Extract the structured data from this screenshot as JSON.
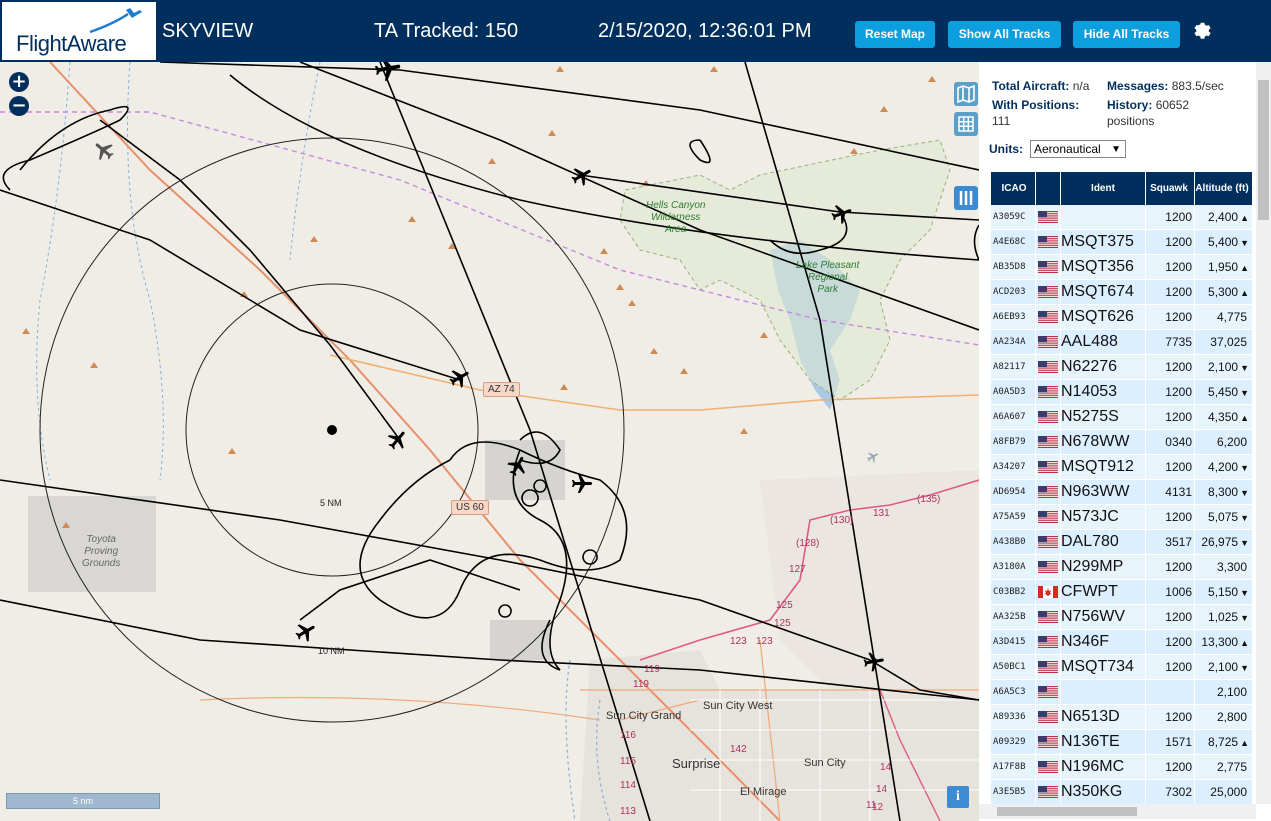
{
  "header": {
    "logo_text": "FlightAware",
    "title": "SKYVIEW",
    "tracked": "TA Tracked: 150",
    "datetime": "2/15/2020, 12:36:01 PM",
    "buttons": {
      "reset_map": "Reset Map",
      "show_all_tracks": "Show All Tracks",
      "hide_all_tracks": "Hide All Tracks"
    }
  },
  "map": {
    "zoom_in": "+",
    "zoom_out": "−",
    "shields": {
      "az74": "AZ 74",
      "us60": "US 60"
    },
    "road_numbers": [
      "(135)",
      "(130)",
      "131",
      "(128)",
      "127",
      "125",
      "125",
      "123",
      "123",
      "119",
      "119",
      "116",
      "115",
      "114",
      "113",
      "142",
      "14",
      "14",
      "12",
      "11"
    ],
    "parks": {
      "hells_canyon": "Hells Canyon\nWilderness\nArea",
      "lake_pleasant": "Lake Pleasant\nRegional\nPark"
    },
    "areas": {
      "toyota": "Toyota\nProving\nGrounds"
    },
    "cities": {
      "sun_city_grand": "Sun City Grand",
      "sun_city_west": "Sun City West",
      "surprise": "Surprise",
      "sun_city": "Sun City",
      "el_mirage": "El Mirage"
    },
    "rings": {
      "five": "5 NM",
      "ten": "10 NM"
    },
    "scale": "5 nm",
    "info": "i"
  },
  "sidebar": {
    "total_aircraft_label": "Total Aircraft:",
    "total_aircraft_value": "n/a",
    "messages_label": "Messages:",
    "messages_value": "883.5/sec",
    "with_positions_label": "With Positions:",
    "with_positions_value": "111",
    "history_label": "History:",
    "history_value": "60652",
    "history_unit": "positions",
    "units_label": "Units:",
    "units_value": "Aeronautical",
    "columns": {
      "icao": "ICAO",
      "ident": "Ident",
      "squawk": "Squawk",
      "altitude": "Altitude (ft)"
    },
    "rows": [
      {
        "icao": "A3059C",
        "flag": "US",
        "ident": "",
        "squawk": "1200",
        "alt": "2,400",
        "trend": "▲"
      },
      {
        "icao": "A4E68C",
        "flag": "US",
        "ident": "MSQT375",
        "squawk": "1200",
        "alt": "5,400",
        "trend": "▼"
      },
      {
        "icao": "AB35D8",
        "flag": "US",
        "ident": "MSQT356",
        "squawk": "1200",
        "alt": "1,950",
        "trend": "▲"
      },
      {
        "icao": "ACD203",
        "flag": "US",
        "ident": "MSQT674",
        "squawk": "1200",
        "alt": "5,300",
        "trend": "▲"
      },
      {
        "icao": "A6EB93",
        "flag": "US",
        "ident": "MSQT626",
        "squawk": "1200",
        "alt": "4,775",
        "trend": ""
      },
      {
        "icao": "AA234A",
        "flag": "US",
        "ident": "AAL488",
        "squawk": "7735",
        "alt": "37,025",
        "trend": ""
      },
      {
        "icao": "A82117",
        "flag": "US",
        "ident": "N62276",
        "squawk": "1200",
        "alt": "2,100",
        "trend": "▼"
      },
      {
        "icao": "A0A5D3",
        "flag": "US",
        "ident": "N14053",
        "squawk": "1200",
        "alt": "5,450",
        "trend": "▼"
      },
      {
        "icao": "A6A607",
        "flag": "US",
        "ident": "N5275S",
        "squawk": "1200",
        "alt": "4,350",
        "trend": "▲"
      },
      {
        "icao": "A8FB79",
        "flag": "US",
        "ident": "N678WW",
        "squawk": "0340",
        "alt": "6,200",
        "trend": ""
      },
      {
        "icao": "A34207",
        "flag": "US",
        "ident": "MSQT912",
        "squawk": "1200",
        "alt": "4,200",
        "trend": "▼"
      },
      {
        "icao": "AD6954",
        "flag": "US",
        "ident": "N963WW",
        "squawk": "4131",
        "alt": "8,300",
        "trend": "▼"
      },
      {
        "icao": "A75A59",
        "flag": "US",
        "ident": "N573JC",
        "squawk": "1200",
        "alt": "5,075",
        "trend": "▼"
      },
      {
        "icao": "A438B0",
        "flag": "US",
        "ident": "DAL780",
        "squawk": "3517",
        "alt": "26,975",
        "trend": "▼"
      },
      {
        "icao": "A3180A",
        "flag": "US",
        "ident": "N299MP",
        "squawk": "1200",
        "alt": "3,300",
        "trend": ""
      },
      {
        "icao": "C03BB2",
        "flag": "CA",
        "ident": "CFWPT",
        "squawk": "1006",
        "alt": "5,150",
        "trend": "▼"
      },
      {
        "icao": "AA325B",
        "flag": "US",
        "ident": "N756WV",
        "squawk": "1200",
        "alt": "1,025",
        "trend": "▼"
      },
      {
        "icao": "A3D415",
        "flag": "US",
        "ident": "N346F",
        "squawk": "1200",
        "alt": "13,300",
        "trend": "▲"
      },
      {
        "icao": "A50BC1",
        "flag": "US",
        "ident": "MSQT734",
        "squawk": "1200",
        "alt": "2,100",
        "trend": "▼"
      },
      {
        "icao": "A6A5C3",
        "flag": "US",
        "ident": "",
        "squawk": "",
        "alt": "2,100",
        "trend": ""
      },
      {
        "icao": "A89336",
        "flag": "US",
        "ident": "N6513D",
        "squawk": "1200",
        "alt": "2,800",
        "trend": ""
      },
      {
        "icao": "A09329",
        "flag": "US",
        "ident": "N136TE",
        "squawk": "1571",
        "alt": "8,725",
        "trend": "▲"
      },
      {
        "icao": "A17F8B",
        "flag": "US",
        "ident": "N196MC",
        "squawk": "1200",
        "alt": "2,775",
        "trend": ""
      },
      {
        "icao": "A3E5B5",
        "flag": "US",
        "ident": "N350KG",
        "squawk": "7302",
        "alt": "25,000",
        "trend": ""
      }
    ]
  },
  "colors": {
    "header_bg": "#002f5d",
    "button_bg": "#0d9ee0",
    "map_bg": "#f0ede6",
    "row_bg": "#dcefff"
  },
  "icons": [
    "settings-gear-icon",
    "zoom-in-icon",
    "zoom-out-icon",
    "map-layers-icon",
    "grid-icon",
    "columns-icon",
    "info-icon",
    "airplane-icon"
  ]
}
